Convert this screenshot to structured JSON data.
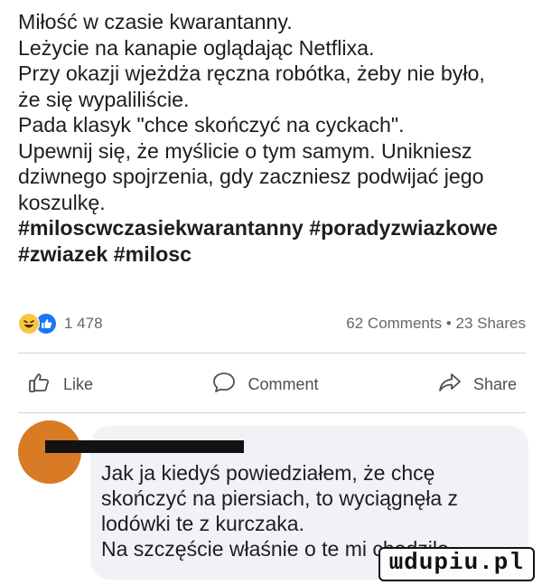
{
  "post": {
    "text": "Miłość w czasie kwarantanny.\nLeżycie na kanapie oglądając Netflixa.\nPrzy okazji wjeżdża ręczna robótka, żeby nie było,\nże się wypaliliście.\nPada klasyk \"chce skończyć na cyckach\".\nUpewnij się, że myślicie o tym samym. Unikniesz\ndziwnego spojrzenia, gdy zaczniesz podwijać jego\nkoszulkę.",
    "hashtags": "#miloscwczasiekwarantanny #poradyzwiazkowe\n#zwiazek #milosc"
  },
  "reactions": {
    "icons": [
      "haha-reaction-icon",
      "like-reaction-icon"
    ],
    "count": "1 478",
    "comments_shares": "62 Comments • 23 Shares"
  },
  "actions": {
    "like": "Like",
    "comment": "Comment",
    "share": "Share"
  },
  "comment": {
    "text": "Jak ja kiedyś powiedziałem, że chcę\nskończyć na piersiach, to wyciągnęła z\nlodówki te z kurczaka.\nNa szczęście właśnie o te mi chodziło"
  },
  "watermark": {
    "text": "ɯdupiu.pl"
  },
  "colors": {
    "like_blue": "#1877f2",
    "haha_yellow": "#f7c744",
    "bubble_gray": "#f0f2f5"
  }
}
